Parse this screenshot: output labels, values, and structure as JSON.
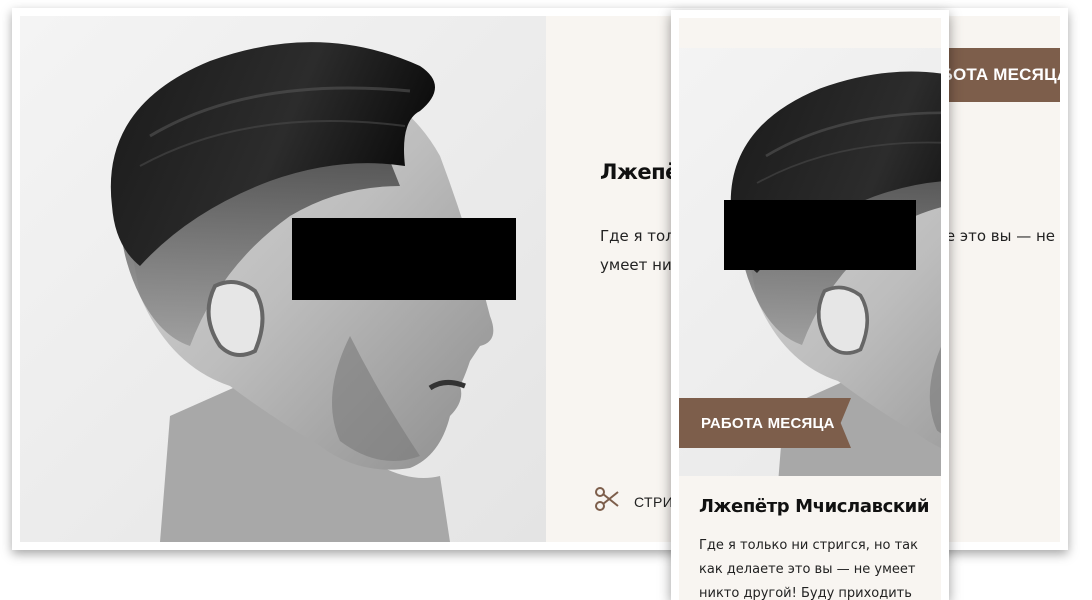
{
  "desktop_card": {
    "name": "Лжепётр Мчиславский",
    "description": "Где я только ни стригся, но так как делаете это вы — не умеет никто другой! Буду приходить ещё.",
    "ribbon": "РАБОТА МЕСЯЦА",
    "service_label": "СТРИЖКА",
    "service_icon": "scissors-icon"
  },
  "mobile_card": {
    "ribbon": "РАБОТА МЕСЯЦА",
    "name": "Лжепётр Мчиславский",
    "description": "Где я только ни стригся, но так как делаете это вы — не умеет никто другой! Буду приходить ещё."
  },
  "colors": {
    "accent_brown": "#7d5e4b",
    "card_background": "#f8f5f1",
    "censor_bar": "#000000"
  }
}
